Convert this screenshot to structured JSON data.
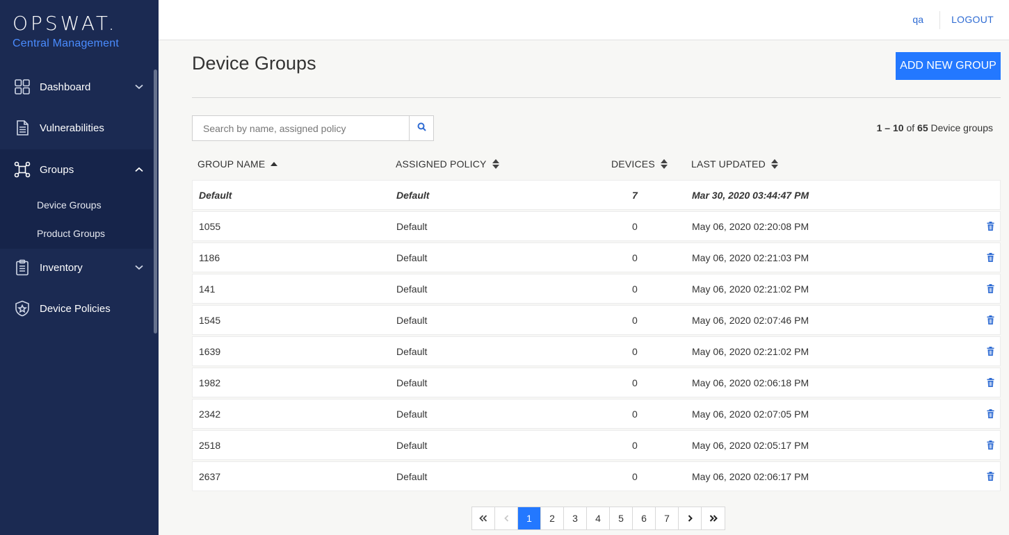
{
  "brand": {
    "logo": "OPSWAT.",
    "subtitle": "Central Management"
  },
  "sidebar": {
    "items": [
      {
        "label": "Dashboard",
        "icon": "dashboard-icon",
        "expandable": true
      },
      {
        "label": "Vulnerabilities",
        "icon": "document-icon",
        "expandable": false
      },
      {
        "label": "Groups",
        "icon": "groups-icon",
        "expandable": true,
        "expanded": true
      },
      {
        "label": "Inventory",
        "icon": "clipboard-icon",
        "expandable": true
      },
      {
        "label": "Device Policies",
        "icon": "shield-icon",
        "expandable": false
      }
    ],
    "groups_sub": [
      "Device Groups",
      "Product Groups"
    ]
  },
  "topbar": {
    "user": "qa",
    "logout": "LOGOUT"
  },
  "page": {
    "title": "Device Groups",
    "add_button": "ADD NEW GROUP",
    "search_placeholder": "Search by name, assigned policy",
    "count_range": "1 – 10",
    "count_of": "of",
    "count_total": "65",
    "count_suffix": "Device groups"
  },
  "table": {
    "headers": [
      "GROUP NAME",
      "ASSIGNED POLICY",
      "DEVICES",
      "LAST UPDATED"
    ],
    "rows": [
      {
        "name": "Default",
        "policy": "Default",
        "devices": "7",
        "updated": "Mar 30, 2020 03:44:47 PM",
        "default": true
      },
      {
        "name": "1055",
        "policy": "Default",
        "devices": "0",
        "updated": "May 06, 2020 02:20:08 PM"
      },
      {
        "name": "1186",
        "policy": "Default",
        "devices": "0",
        "updated": "May 06, 2020 02:21:03 PM"
      },
      {
        "name": "141",
        "policy": "Default",
        "devices": "0",
        "updated": "May 06, 2020 02:21:02 PM"
      },
      {
        "name": "1545",
        "policy": "Default",
        "devices": "0",
        "updated": "May 06, 2020 02:07:46 PM"
      },
      {
        "name": "1639",
        "policy": "Default",
        "devices": "0",
        "updated": "May 06, 2020 02:21:02 PM"
      },
      {
        "name": "1982",
        "policy": "Default",
        "devices": "0",
        "updated": "May 06, 2020 02:06:18 PM"
      },
      {
        "name": "2342",
        "policy": "Default",
        "devices": "0",
        "updated": "May 06, 2020 02:07:05 PM"
      },
      {
        "name": "2518",
        "policy": "Default",
        "devices": "0",
        "updated": "May 06, 2020 02:05:17 PM"
      },
      {
        "name": "2637",
        "policy": "Default",
        "devices": "0",
        "updated": "May 06, 2020 02:06:17 PM"
      }
    ]
  },
  "pagination": {
    "pages": [
      "1",
      "2",
      "3",
      "4",
      "5",
      "6",
      "7"
    ],
    "current": "1"
  },
  "colors": {
    "sidebar": "#1b2a52",
    "accent": "#2378ff",
    "link": "#2e6bd3"
  }
}
